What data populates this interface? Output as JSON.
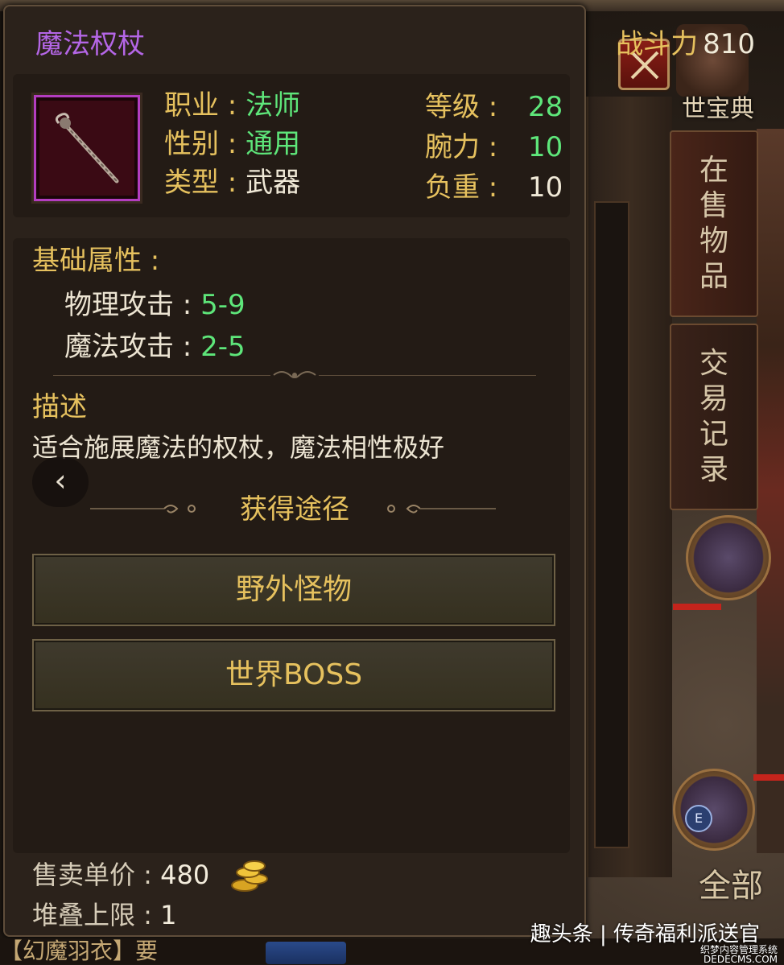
{
  "item": {
    "name": "魔法权杖",
    "power_label": "战斗力",
    "power_value": "810",
    "class_label": "职业 : ",
    "class_value": "法师",
    "gender_label": "性别 : ",
    "gender_value": "通用",
    "type_label": "类型 : ",
    "type_value": "武器",
    "level_label": "等级 :",
    "level_value": "28",
    "strength_label": "腕力 :",
    "strength_value": "10",
    "weight_label": "负重 :",
    "weight_value": "10"
  },
  "base_attrs": {
    "heading": "基础属性 :",
    "phys_label": "物理攻击 : ",
    "phys_value": "5-9",
    "magic_label": "魔法攻击 : ",
    "magic_value": "2-5"
  },
  "description": {
    "heading": "描述",
    "text": "适合施展魔法的权杖，魔法相性极好"
  },
  "sources": {
    "heading": "获得途径",
    "buttons": [
      "野外怪物",
      "世界BOSS"
    ]
  },
  "footer": {
    "sell_label": "售卖单价 : ",
    "sell_value": "480",
    "stack_label": "堆叠上限 : ",
    "stack_value": "1"
  },
  "side": {
    "treasure_label": "世宝典",
    "tab_onsale": "在售物品",
    "tab_records": "交易记录",
    "all_label": "全部",
    "e_badge": "E"
  },
  "bottom": {
    "left_text": "【幻魔羽衣】要",
    "watermark": "趣头条 | 传奇福利派送官",
    "watermark_small": "织梦内容管理系统\nDEDECMS.COM"
  },
  "colors": {
    "title_purple": "#b466e6",
    "label_gold": "#e6c15e",
    "value_green": "#5ee67a",
    "rarity_border": "#b33dc0"
  }
}
